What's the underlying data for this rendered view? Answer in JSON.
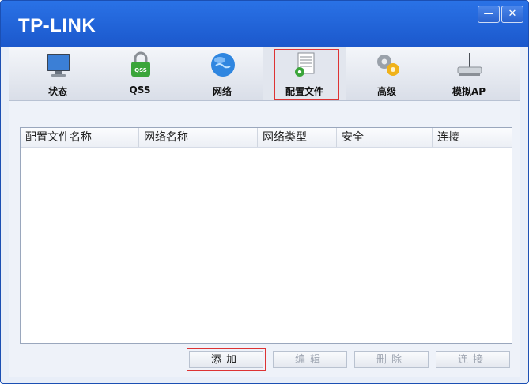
{
  "app": {
    "brand": "TP-LINK",
    "minimize_glyph": "—",
    "close_glyph": "✕"
  },
  "toolbar": {
    "items": [
      {
        "label": "状态",
        "icon": "monitor-icon"
      },
      {
        "label": "QSS",
        "icon": "qss-lock-icon",
        "badge": "QSS"
      },
      {
        "label": "网络",
        "icon": "globe-icon"
      },
      {
        "label": "配置文件",
        "icon": "profile-document-icon",
        "active": true
      },
      {
        "label": "高级",
        "icon": "gears-icon"
      },
      {
        "label": "模拟AP",
        "icon": "router-icon"
      }
    ]
  },
  "profile_list": {
    "columns": [
      "配置文件名称",
      "网络名称",
      "网络类型",
      "安全",
      "连接"
    ],
    "rows": []
  },
  "actions": {
    "add": "添加",
    "edit": "编辑",
    "delete": "删除",
    "connect": "连接"
  },
  "colors": {
    "accent": "#1b58cc",
    "highlight": "#dd3333"
  }
}
